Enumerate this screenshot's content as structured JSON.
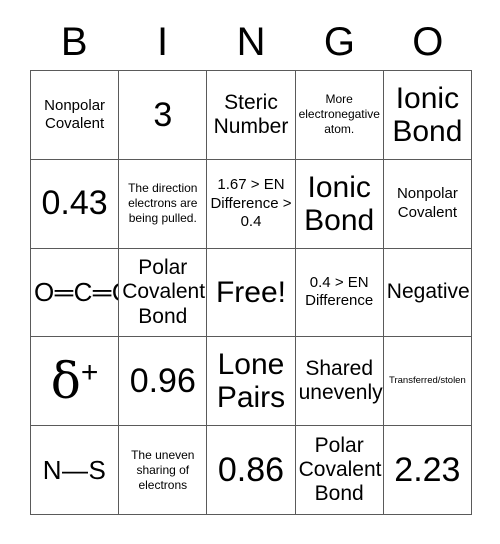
{
  "card": {
    "title_letters": [
      "B",
      "I",
      "N",
      "G",
      "O"
    ],
    "free_space_label": "Free!",
    "grid": [
      [
        {
          "text": "Nonpolar Covalent",
          "size": "sm"
        },
        {
          "text": "3",
          "size": "xl"
        },
        {
          "text": "Steric Number",
          "size": "md"
        },
        {
          "text": "More electronegative atom.",
          "size": "xs"
        },
        {
          "text": "Ionic Bond",
          "size": "lg"
        }
      ],
      [
        {
          "text": "0.43",
          "size": "xl"
        },
        {
          "text": "The direction electrons are being pulled.",
          "size": "xs"
        },
        {
          "text": "1.67 > EN Difference > 0.4",
          "size": "sm"
        },
        {
          "text": "Ionic Bond",
          "size": "lg"
        },
        {
          "text": "Nonpolar Covalent",
          "size": "sm"
        }
      ],
      [
        {
          "text": "O=C=O",
          "size": "chem"
        },
        {
          "text": "Polar Covalent Bond",
          "size": "md"
        },
        {
          "text": "Free!",
          "size": "lg"
        },
        {
          "text": "0.4 > EN Difference",
          "size": "sm"
        },
        {
          "text": "Negative",
          "size": "md"
        }
      ],
      [
        {
          "text": "δ+",
          "size": "delta"
        },
        {
          "text": "0.96",
          "size": "xl"
        },
        {
          "text": "Lone Pairs",
          "size": "lg"
        },
        {
          "text": "Shared unevenly",
          "size": "md"
        },
        {
          "text": "Transferred/stolen",
          "size": "xxs"
        }
      ],
      [
        {
          "text": "N—S",
          "size": "chem"
        },
        {
          "text": "The uneven sharing of electrons",
          "size": "xs"
        },
        {
          "text": "0.86",
          "size": "xl"
        },
        {
          "text": "Polar Covalent Bond",
          "size": "md"
        },
        {
          "text": "2.23",
          "size": "xl"
        }
      ]
    ]
  },
  "colors": {
    "background": "#ffffff",
    "text": "#000000",
    "grid_line": "#5a5a5a"
  }
}
